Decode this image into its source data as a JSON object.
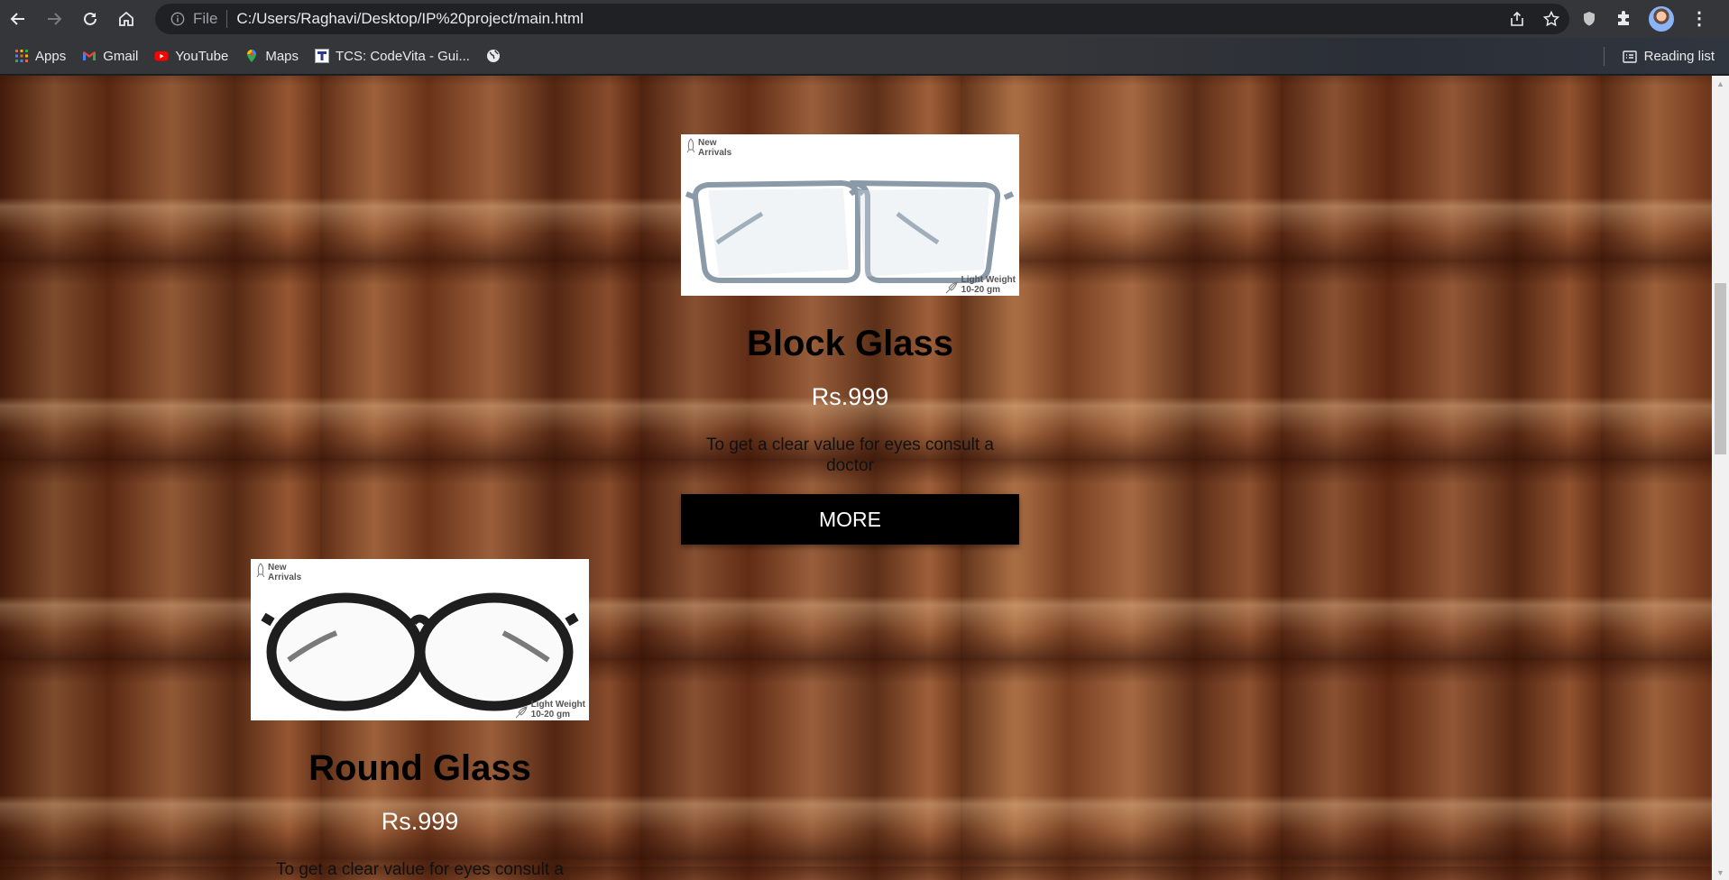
{
  "browser": {
    "address": {
      "scheme_label": "File",
      "url": "C:/Users/Raghavi/Desktop/IP%20project/main.html"
    },
    "bookmarks": [
      {
        "label": "Apps",
        "icon": "apps-grid-icon"
      },
      {
        "label": "Gmail",
        "icon": "gmail-icon"
      },
      {
        "label": "YouTube",
        "icon": "youtube-icon"
      },
      {
        "label": "Maps",
        "icon": "maps-pin-icon"
      },
      {
        "label": "TCS: CodeVita - Gui...",
        "icon": "tcs-icon"
      },
      {
        "label": "",
        "icon": "globe-icon"
      }
    ],
    "reading_list": "Reading list"
  },
  "products": [
    {
      "badge_new": [
        "New",
        "Arrivals"
      ],
      "badge_weight": [
        "Light Weight",
        "10-20 gm"
      ],
      "title": "Block Glass",
      "price": "Rs.999",
      "description": "To get a clear value for eyes consult a doctor",
      "button": "MORE",
      "frame_color": "#8a9aa8"
    },
    {
      "badge_new": [
        "New",
        "Arrivals"
      ],
      "badge_weight": [
        "Light Weight",
        "10-20 gm"
      ],
      "title": "Round Glass",
      "price": "Rs.999",
      "description": "To get a clear value for eyes consult a doctor",
      "frame_color": "#1e1e1e"
    }
  ]
}
